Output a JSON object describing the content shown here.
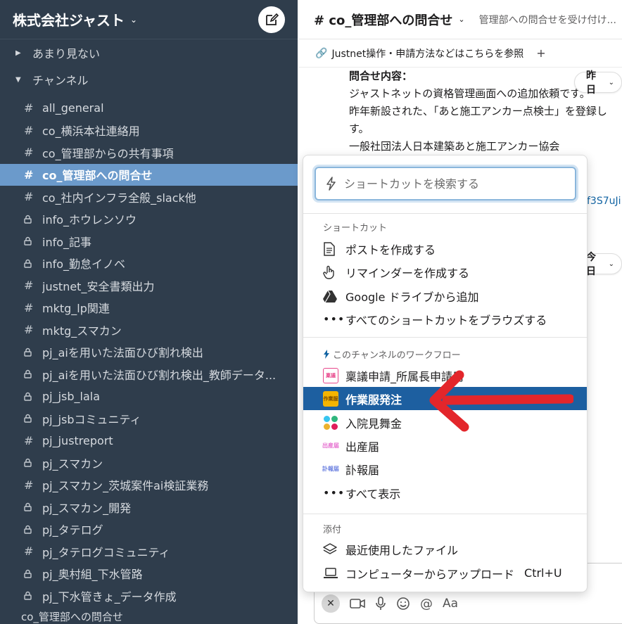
{
  "workspace": {
    "name": "株式会社ジャスト"
  },
  "sidebar": {
    "sections": [
      {
        "label": "あまり見ない",
        "collapsed": true
      },
      {
        "label": "チャンネル",
        "collapsed": false
      }
    ],
    "channels": [
      {
        "label": "all_general",
        "private": false,
        "active": false
      },
      {
        "label": "co_横浜本社連絡用",
        "private": false,
        "active": false
      },
      {
        "label": "co_管理部からの共有事項",
        "private": false,
        "active": false
      },
      {
        "label": "co_管理部への問合せ",
        "private": false,
        "active": true
      },
      {
        "label": "co_社内インフラ全般_slack他",
        "private": false,
        "active": false
      },
      {
        "label": "info_ホウレンソウ",
        "private": true,
        "active": false
      },
      {
        "label": "info_記事",
        "private": true,
        "active": false
      },
      {
        "label": "info_勤怠イノベ",
        "private": true,
        "active": false
      },
      {
        "label": "justnet_安全書類出力",
        "private": false,
        "active": false
      },
      {
        "label": "mktg_lp関連",
        "private": false,
        "active": false
      },
      {
        "label": "mktg_スマカン",
        "private": false,
        "active": false
      },
      {
        "label": "pj_aiを用いた法面ひび割れ検出",
        "private": true,
        "active": false
      },
      {
        "label": "pj_aiを用いた法面ひび割れ検出_教師データ...",
        "private": true,
        "active": false
      },
      {
        "label": "pj_jsb_lala",
        "private": true,
        "active": false
      },
      {
        "label": "pj_jsbコミュニティ",
        "private": true,
        "active": false
      },
      {
        "label": "pj_justreport",
        "private": false,
        "active": false
      },
      {
        "label": "pj_スマカン",
        "private": true,
        "active": false
      },
      {
        "label": "pj_スマカン_茨城案件ai検証業務",
        "private": false,
        "active": false
      },
      {
        "label": "pj_スマカン_開発",
        "private": true,
        "active": false
      },
      {
        "label": "pj_タテログ",
        "private": true,
        "active": false
      },
      {
        "label": "pj_タテログコミュニティ",
        "private": false,
        "active": false
      },
      {
        "label": "pj_奥村組_下水管路",
        "private": true,
        "active": false
      },
      {
        "label": "pj_下水管きょ_データ作成",
        "private": true,
        "active": false
      }
    ],
    "footer_label": "co_管理部への問合せ"
  },
  "channel_header": {
    "title": "# co_管理部への問合せ",
    "topic": "管理部への問合せを受け付け..."
  },
  "bookmarks": {
    "link_label": "Justnet操作・申請方法などはこちらを参照",
    "add": "+"
  },
  "message": {
    "heading": "問合せ内容：",
    "lines": [
      "ジャストネットの資格管理画面への追加依頼です。",
      "昨年新設された、「あと施工アンカー点検士」を登録し",
      "す。",
      "一般社団法人日本建築あと施工アンカー協会"
    ],
    "link_fragment": "f3S7uJi"
  },
  "date_pills": {
    "yesterday": "昨日",
    "today": "今日"
  },
  "shortcut_popup": {
    "search_placeholder": "ショートカットを検索する",
    "shortcuts_title": "ショートカット",
    "shortcuts": [
      {
        "label": "ポストを作成する",
        "icon": "document-icon"
      },
      {
        "label": "リマインダーを作成する",
        "icon": "hand-icon"
      },
      {
        "label": "Google ドライブから追加",
        "icon": "google-drive-icon"
      },
      {
        "label": "すべてのショートカットをブラウズする",
        "icon": "more-dots-icon"
      }
    ],
    "workflows_title": "このチャンネルのワークフロー",
    "workflows": [
      {
        "label": "稟議申請_所属長申請用",
        "icon_text": "稟議",
        "color": "#e8478b",
        "selected": false
      },
      {
        "label": "作業服発注",
        "icon_text": "作業服",
        "color": "#f4b400",
        "selected": true
      },
      {
        "label": "入院見舞金",
        "icon_text": "",
        "color": "#3fb37f",
        "selected": false
      },
      {
        "label": "出産届",
        "icon_text": "出産届",
        "color": "#e66fd0",
        "selected": false
      },
      {
        "label": "訃報届",
        "icon_text": "訃報届",
        "color": "#6a7fe0",
        "selected": false
      },
      {
        "label": "すべて表示",
        "icon_text": "",
        "color": "",
        "selected": false
      }
    ],
    "attach_title": "添付",
    "attach": [
      {
        "label": "最近使用したファイル",
        "icon": "layers-icon"
      },
      {
        "label": "コンピューターからアップロード",
        "icon": "laptop-icon",
        "shortcut": "Ctrl+U"
      }
    ]
  },
  "composer": {
    "format_label": "Aa"
  },
  "colors": {
    "sidebar_bg": "#2f3d4c",
    "active_channel": "#6b9acb",
    "selected_item": "#1d5fa0",
    "annotation_arrow": "#e3262b"
  }
}
